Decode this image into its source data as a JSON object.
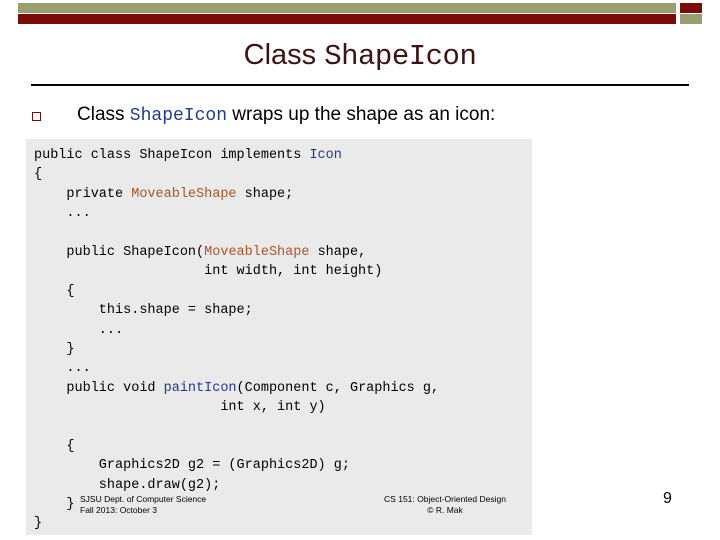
{
  "banner": {
    "sage_color": "#9a9d6e",
    "maroon_color": "#7b0b09"
  },
  "slide": {
    "title_prefix": "Class ",
    "title_code": "ShapeIcon",
    "title_color": "#3f1210"
  },
  "bullet": {
    "marker": "square-outline-bullet",
    "text_before": "Class ",
    "code_term": "ShapeIcon",
    "text_after": " wraps up the shape as an icon:"
  },
  "code": {
    "accent_blue": "#23398e",
    "accent_brown": "#a8552b",
    "background": "#eaeaea",
    "lines": [
      [
        {
          "t": "public class ShapeIcon implements ",
          "c": "plain"
        },
        {
          "t": "Icon",
          "c": "blue"
        }
      ],
      [
        {
          "t": "{",
          "c": "plain"
        }
      ],
      [
        {
          "t": "    private ",
          "c": "plain"
        },
        {
          "t": "MoveableShape",
          "c": "brown"
        },
        {
          "t": " shape;",
          "c": "plain"
        }
      ],
      [
        {
          "t": "    ...",
          "c": "plain"
        }
      ],
      [
        {
          "t": "",
          "c": "plain"
        }
      ],
      [
        {
          "t": "    public ShapeIcon(",
          "c": "plain"
        },
        {
          "t": "MoveableShape",
          "c": "brown"
        },
        {
          "t": " shape,",
          "c": "plain"
        }
      ],
      [
        {
          "t": "                     int width, int height)",
          "c": "plain"
        }
      ],
      [
        {
          "t": "    {",
          "c": "plain"
        }
      ],
      [
        {
          "t": "        this.shape = shape;",
          "c": "plain"
        }
      ],
      [
        {
          "t": "        ...",
          "c": "plain"
        }
      ],
      [
        {
          "t": "    }",
          "c": "plain"
        }
      ],
      [
        {
          "t": "    ...",
          "c": "plain"
        }
      ],
      [
        {
          "t": "    public void ",
          "c": "plain"
        },
        {
          "t": "paintIcon",
          "c": "blue"
        },
        {
          "t": "(Component c, Graphics g,",
          "c": "plain"
        }
      ],
      [
        {
          "t": "                       int x, int y)",
          "c": "plain"
        }
      ],
      [
        {
          "t": "",
          "c": "plain"
        }
      ],
      [
        {
          "t": "    {",
          "c": "plain"
        }
      ],
      [
        {
          "t": "        Graphics2D g2 = (Graphics2D) g;",
          "c": "plain"
        }
      ],
      [
        {
          "t": "        shape.draw(g2);",
          "c": "plain"
        }
      ],
      [
        {
          "t": "    }",
          "c": "plain"
        }
      ],
      [
        {
          "t": "}",
          "c": "plain"
        }
      ]
    ]
  },
  "footer": {
    "left_line1": "SJSU Dept. of Computer Science",
    "left_line2": "Fall 2013: October 3",
    "right_line1": "CS 151: Object-Oriented Design",
    "right_line2": "© R. Mak",
    "page_number": "9"
  }
}
